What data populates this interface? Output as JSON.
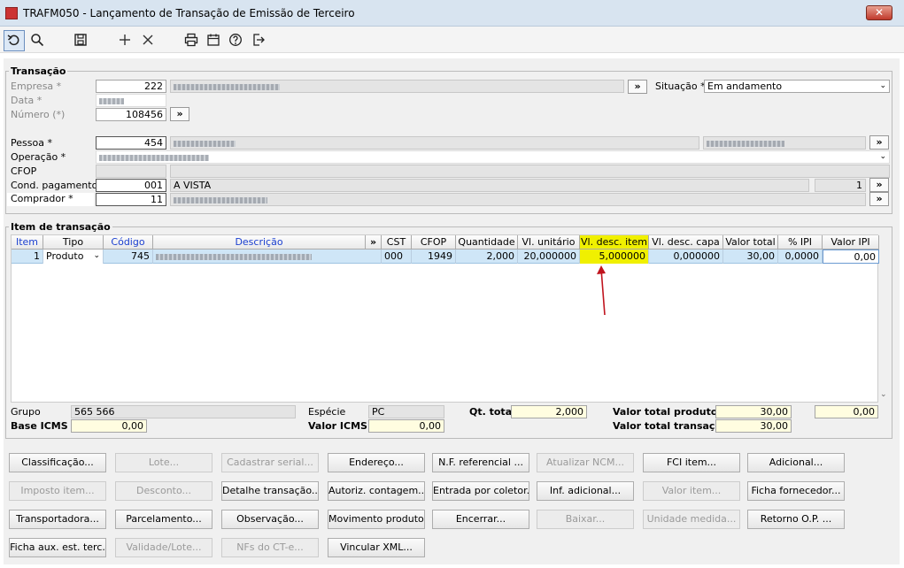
{
  "window": {
    "title": "TRAFM050 - Lançamento de Transação de Emissão de Terceiro",
    "close": "✕"
  },
  "toolbar": {
    "icons": [
      "undo-icon",
      "search-icon",
      "save-icon",
      "add-icon",
      "cancel-icon",
      "print-icon",
      "calendar-icon",
      "help-icon",
      "exit-icon"
    ]
  },
  "transacao": {
    "legend": "Transação",
    "empresa_label": "Empresa *",
    "empresa_code": "222",
    "data_label": "Data *",
    "numero_label": "Número (*)",
    "numero_value": "108456",
    "situacao_label": "Situação *",
    "situacao_value": "Em andamento",
    "pessoa_label": "Pessoa *",
    "pessoa_code": "454",
    "operacao_label": "Operação *",
    "cfop_label": "CFOP",
    "cond_label": "Cond. pagamento *",
    "cond_code": "001",
    "cond_desc": "A VISTA",
    "cond_parcelas": "1",
    "comprador_label": "Comprador *",
    "comprador_code": "11",
    "more": "»"
  },
  "item": {
    "legend": "Item de transação",
    "columns": [
      "Item",
      "Tipo",
      "Código",
      "Descrição",
      "»",
      "CST",
      "CFOP",
      "Quantidade",
      "Vl. unitário",
      "Vl. desc. item",
      "Vl. desc. capa",
      "Valor total",
      "% IPI",
      "Valor IPI"
    ],
    "row": {
      "item": "1",
      "tipo": "Produto",
      "codigo": "745",
      "cst": "000",
      "cfop": "1949",
      "quantidade": "2,000",
      "vl_unitario": "20,000000",
      "vl_desc_item": "5,000000",
      "vl_desc_capa": "0,000000",
      "valor_total": "30,00",
      "pct_ipi": "0,0000",
      "valor_ipi": "0,00"
    },
    "grupo_label": "Grupo",
    "grupo_value": "565 566",
    "especie_label": "Espécie",
    "especie_value": "PC",
    "qt_total_label": "Qt. total",
    "qt_total_value": "2,000",
    "valor_total_produto_label": "Valor total produto",
    "valor_total_produto_value": "30,00",
    "extra_value": "0,00",
    "base_icms_label": "Base ICMS",
    "base_icms_value": "0,00",
    "valor_icms_label": "Valor ICMS",
    "valor_icms_value": "0,00",
    "valor_total_transacao_label": "Valor total transação",
    "valor_total_transacao_value": "30,00"
  },
  "buttons": [
    [
      "Classificação...",
      "Lote...",
      "Cadastrar serial...",
      "Endereço...",
      "N.F. referencial ...",
      "Atualizar NCM...",
      "FCI item...",
      "Adicional..."
    ],
    [
      "Imposto item...",
      "Desconto...",
      "Detalhe transação...",
      "Autoriz. contagem...",
      "Entrada por coletor...",
      "Inf. adicional...",
      "Valor item...",
      "Ficha fornecedor..."
    ],
    [
      "Transportadora...",
      "Parcelamento...",
      "Observação...",
      "Movimento produto...",
      "Encerrar...",
      "Baixar...",
      "Unidade medida...",
      "Retorno O.P. ..."
    ],
    [
      "Ficha aux. est. terc.",
      "Validade/Lote...",
      "NFs do CT-e...",
      "Vincular XML..."
    ]
  ],
  "colors": {
    "highlight": "#f0f000",
    "arrow": "#c0141e",
    "row_selected": "#cfe6f7"
  }
}
